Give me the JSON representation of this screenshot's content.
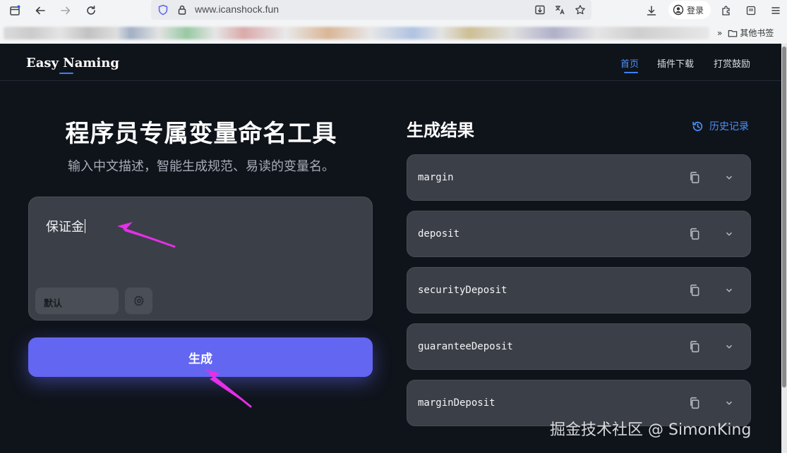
{
  "browser": {
    "url": "www.icanshock.fun",
    "login_label": "登录",
    "bookmarks_folder": "其他书签"
  },
  "nav": {
    "logo": "Easy Naming",
    "items": [
      {
        "label": "首页",
        "active": true
      },
      {
        "label": "插件下载",
        "active": false
      },
      {
        "label": "打赏鼓励",
        "active": false
      }
    ]
  },
  "hero": {
    "title": "程序员专属变量命名工具",
    "subtitle": "输入中文描述，智能生成规范、易读的变量名。"
  },
  "input": {
    "value": "保证金",
    "style_option": "默认"
  },
  "generate_label": "生成",
  "results": {
    "title": "生成结果",
    "history_label": "历史记录",
    "items": [
      "margin",
      "deposit",
      "securityDeposit",
      "guaranteeDeposit",
      "marginDeposit"
    ]
  },
  "watermark": "掘金技术社区 @ SimonKing",
  "colors": {
    "accent": "#6366f1",
    "link": "#4f8ff7",
    "background": "#0f141b",
    "card": "#3b3f47",
    "annotation_arrow": "#e52fe8"
  }
}
